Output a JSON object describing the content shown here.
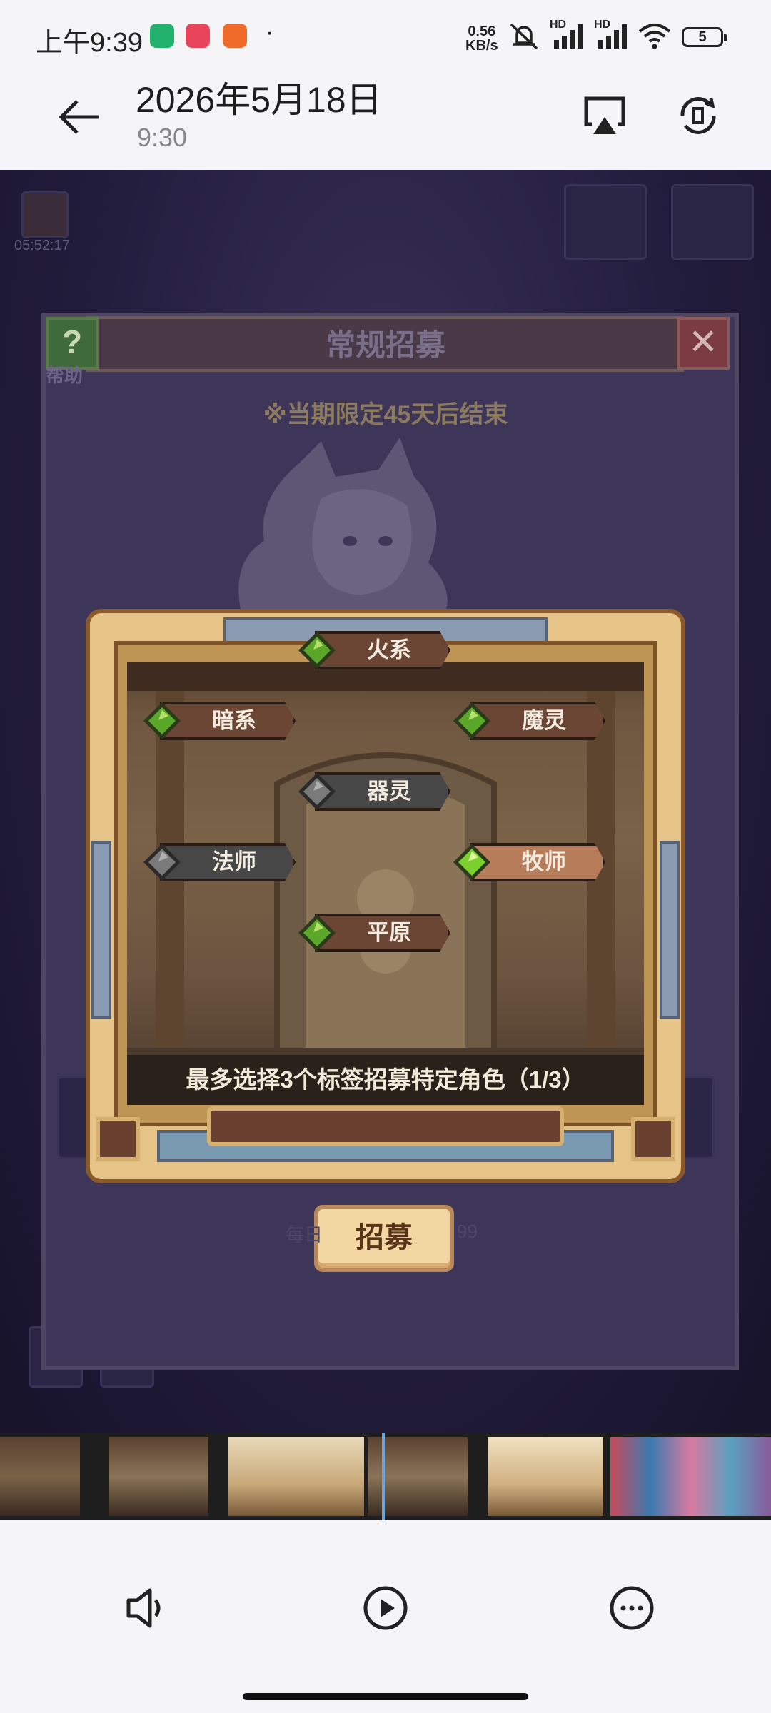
{
  "status_bar": {
    "time": "上午9:39",
    "dot": "·",
    "net_speed_value": "0.56",
    "net_speed_unit": "KB/s",
    "signal1_label": "HD",
    "signal2_label": "HD",
    "battery": "5"
  },
  "header": {
    "date": "2026年5月18日",
    "time": "9:30"
  },
  "game": {
    "timer": "05:52:17",
    "panel_title": "常规招募",
    "help_label": "帮助",
    "limit_notice": "※当期限定45天后结束",
    "recruit_button": "招募",
    "daily_left": "每日",
    "daily_right": "99",
    "dialog": {
      "tags": [
        {
          "label": "火系",
          "state": "normal"
        },
        {
          "label": "暗系",
          "state": "normal"
        },
        {
          "label": "魔灵",
          "state": "normal"
        },
        {
          "label": "器灵",
          "state": "disabled"
        },
        {
          "label": "法师",
          "state": "disabled"
        },
        {
          "label": "牧师",
          "state": "selected"
        },
        {
          "label": "平原",
          "state": "normal"
        }
      ],
      "tip": "最多选择3个标签招募特定角色（1/3）"
    }
  },
  "toolbar": {
    "volume": "volume-icon",
    "play": "play-icon",
    "more": "more-icon"
  },
  "colors": {
    "gem_green": "#5aa72a",
    "gem_gray": "#7a7a7a",
    "frame_gold": "#e6c487",
    "brown": "#6b4634"
  }
}
